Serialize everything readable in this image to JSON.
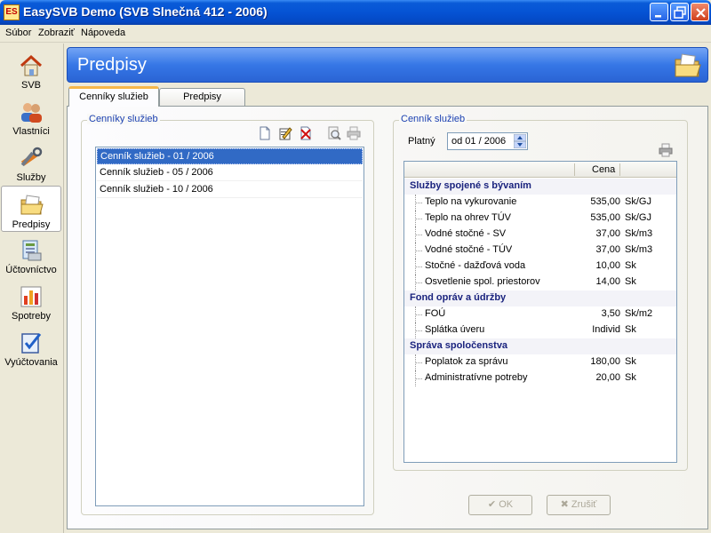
{
  "window": {
    "title": "EasySVB Demo  (SVB Slnečná 412 - 2006)",
    "icon_text": "ES"
  },
  "menu": [
    "Súbor",
    "Zobraziť",
    "Nápoveda"
  ],
  "nav": [
    {
      "label": "SVB",
      "icon": "house-icon"
    },
    {
      "label": "Vlastníci",
      "icon": "people-icon"
    },
    {
      "label": "Služby",
      "icon": "tools-icon"
    },
    {
      "label": "Predpisy",
      "icon": "folder-icon",
      "active": true
    },
    {
      "label": "Účtovníctvo",
      "icon": "ledger-icon"
    },
    {
      "label": "Spotreby",
      "icon": "bar-chart-icon"
    },
    {
      "label": "Vyúčtovania",
      "icon": "checklist-icon"
    }
  ],
  "header": {
    "title": "Predpisy"
  },
  "tabs": [
    "Cenníky služieb",
    "Predpisy"
  ],
  "left_group": {
    "legend": "Cenníky služieb",
    "items": [
      "Cenník služieb - 01 / 2006",
      "Cenník služieb - 05 / 2006",
      "Cenník služieb - 10 / 2006"
    ]
  },
  "right_group": {
    "legend": "Cenník služieb",
    "platny_label": "Platný",
    "platny_value": "od 01 / 2006",
    "col_cena": "Cena",
    "rows": [
      {
        "type": "cat",
        "name": "Služby spojené s bývaním"
      },
      {
        "type": "item",
        "name": "Teplo na vykurovanie",
        "price": "535,00",
        "unit": "Sk/GJ"
      },
      {
        "type": "item",
        "name": "Teplo na ohrev TÚV",
        "price": "535,00",
        "unit": "Sk/GJ"
      },
      {
        "type": "item",
        "name": "Vodné stočné - SV",
        "price": "37,00",
        "unit": "Sk/m3"
      },
      {
        "type": "item",
        "name": "Vodné stočné - TÚV",
        "price": "37,00",
        "unit": "Sk/m3"
      },
      {
        "type": "item",
        "name": "Stočné - dažďová voda",
        "price": "10,00",
        "unit": "Sk"
      },
      {
        "type": "item",
        "name": "Osvetlenie spol. priestorov",
        "price": "14,00",
        "unit": "Sk"
      },
      {
        "type": "cat",
        "name": "Fond opráv a údržby"
      },
      {
        "type": "item",
        "name": "FOÚ",
        "price": "3,50",
        "unit": "Sk/m2"
      },
      {
        "type": "item",
        "name": "Splátka úveru",
        "price": "Individ",
        "unit": "Sk"
      },
      {
        "type": "cat",
        "name": "Správa spoločenstva"
      },
      {
        "type": "item",
        "name": "Poplatok za správu",
        "price": "180,00",
        "unit": "Sk"
      },
      {
        "type": "item",
        "name": "Administratívne potreby",
        "price": "20,00",
        "unit": "Sk"
      }
    ]
  },
  "buttons": {
    "ok": "OK",
    "cancel": "Zrušiť"
  }
}
